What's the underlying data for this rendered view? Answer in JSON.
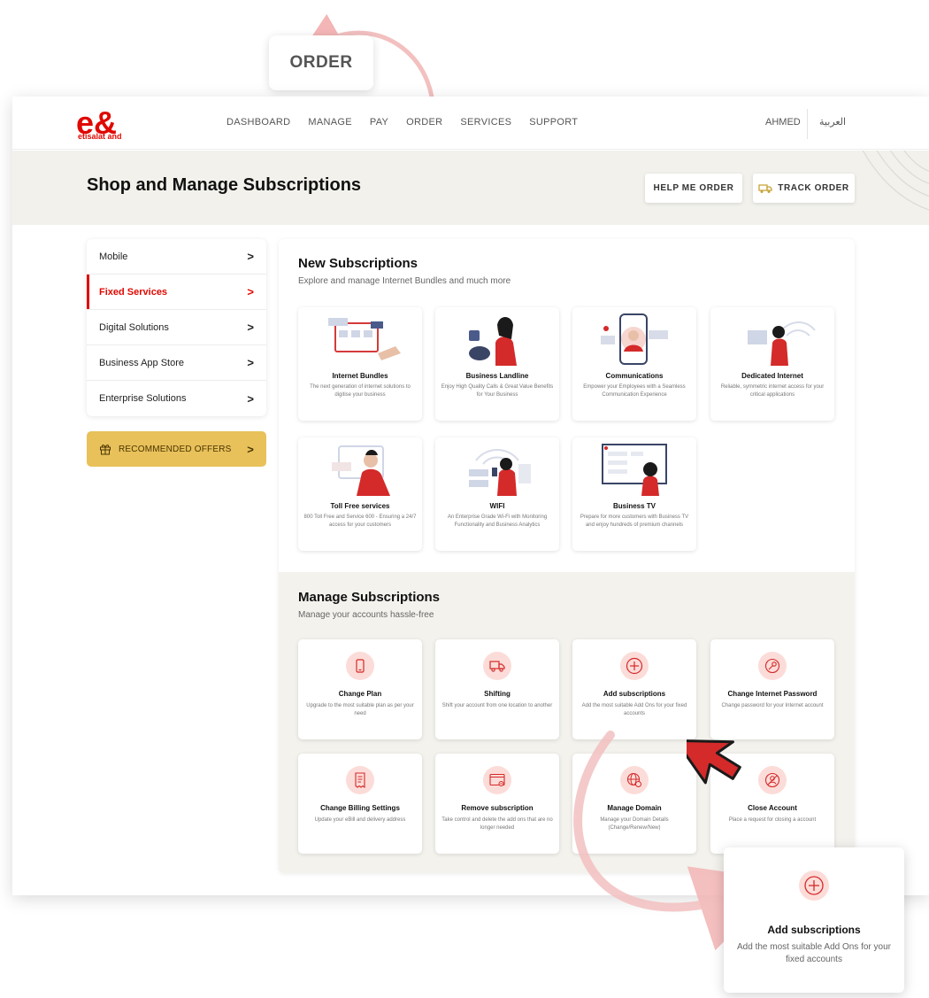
{
  "callout": {
    "label": "ORDER"
  },
  "brand": {
    "logo_text": "e&",
    "sub": "etisalat and"
  },
  "nav": {
    "links": [
      "DASHBOARD",
      "MANAGE",
      "PAY",
      "ORDER",
      "SERVICES",
      "SUPPORT"
    ],
    "user": "AHMED",
    "language": "العربية"
  },
  "hero": {
    "title": "Shop and Manage Subscriptions",
    "help_button": "HELP ME ORDER",
    "track_button": "TRACK ORDER"
  },
  "sidebar": {
    "items": [
      {
        "label": "Mobile",
        "active": false
      },
      {
        "label": "Fixed Services",
        "active": true
      },
      {
        "label": "Digital Solutions",
        "active": false
      },
      {
        "label": "Business App Store",
        "active": false
      },
      {
        "label": "Enterprise Solutions",
        "active": false
      }
    ],
    "recommended": "RECOMMENDED OFFERS"
  },
  "new_subscriptions": {
    "title": "New Subscriptions",
    "subtitle": "Explore and manage Internet Bundles and much more",
    "cards": [
      {
        "title": "Internet Bundles",
        "desc": "The next generation of internet solutions to digitise your business"
      },
      {
        "title": "Business Landline",
        "desc": "Enjoy High Quality Calls & Great Value Benefits for Your Business"
      },
      {
        "title": "Communications",
        "desc": "Empower your Employees with a Seamless Communication Experience"
      },
      {
        "title": "Dedicated Internet",
        "desc": "Reliable, symmetric internet access for your critical applications"
      },
      {
        "title": "Toll Free services",
        "desc": "800 Toll Free and Service 600 - Ensuring a 24/7 access for your customers"
      },
      {
        "title": "WIFI",
        "desc": "An Enterprise Grade Wi-Fi with Monitoring Functionality and Business Analytics"
      },
      {
        "title": "Business TV",
        "desc": "Prepare for more customers with Business TV and enjoy hundreds of premium channels"
      }
    ]
  },
  "manage_subscriptions": {
    "title": "Manage Subscriptions",
    "subtitle": "Manage your accounts hassle-free",
    "cards": [
      {
        "title": "Change Plan",
        "desc": "Upgrade to the most suitable plan as per your need",
        "icon": "phone-icon"
      },
      {
        "title": "Shifting",
        "desc": "Shift your account from one location to another",
        "icon": "truck-icon"
      },
      {
        "title": "Add subscriptions",
        "desc": "Add the most suitable Add Ons for your fixed accounts",
        "icon": "plus-circle-icon"
      },
      {
        "title": "Change Internet Password",
        "desc": "Change password for your Internet account",
        "icon": "key-icon"
      },
      {
        "title": "Change Billing Settings",
        "desc": "Update your eBill and delivery address",
        "icon": "bill-icon"
      },
      {
        "title": "Remove subscription",
        "desc": "Take control and delete the add ons that are no longer needed",
        "icon": "window-remove-icon"
      },
      {
        "title": "Manage Domain",
        "desc": "Manage your Domain Details (Change/Renew/New)",
        "icon": "globe-icon"
      },
      {
        "title": "Close Account",
        "desc": "Place a request for closing a account",
        "icon": "close-account-icon"
      }
    ]
  },
  "zoom": {
    "title": "Add subscriptions",
    "desc": "Add the most suitable Add Ons for your fixed accounts"
  },
  "colors": {
    "brand_red": "#e00800",
    "accent_yellow": "#e8c15b",
    "hero_bg": "#f2f1ec",
    "icon_bg": "#fcdcd8"
  }
}
